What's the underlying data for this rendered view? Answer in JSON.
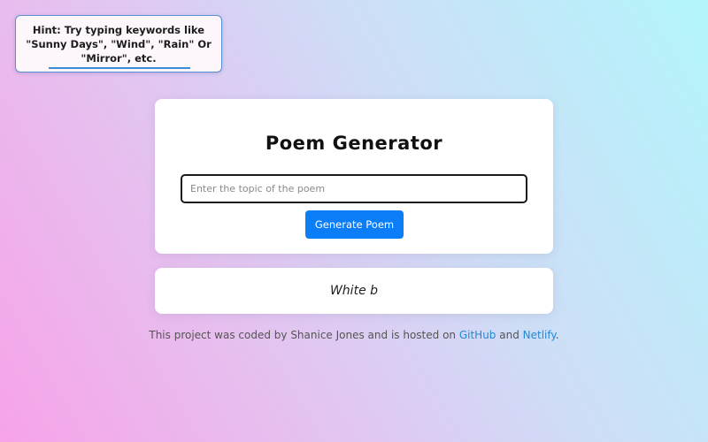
{
  "hint": {
    "text": "Hint: Try typing keywords like \"Sunny Days\", \"Wind\", \"Rain\" Or \"Mirror\", etc."
  },
  "generator": {
    "title": "Poem Generator",
    "input_placeholder": "Enter the topic of the poem",
    "input_value": "",
    "button_label": "Generate Poem"
  },
  "poem": {
    "text": "White b"
  },
  "footer": {
    "prefix": "This project was coded by Shanice Jones and is hosted on ",
    "github_label": "GitHub",
    "middle": " and ",
    "netlify_label": "Netlify",
    "suffix": "."
  },
  "colors": {
    "button": "#0b7df7",
    "link": "#1f8ad6",
    "hint_border": "#5b8fd6"
  }
}
